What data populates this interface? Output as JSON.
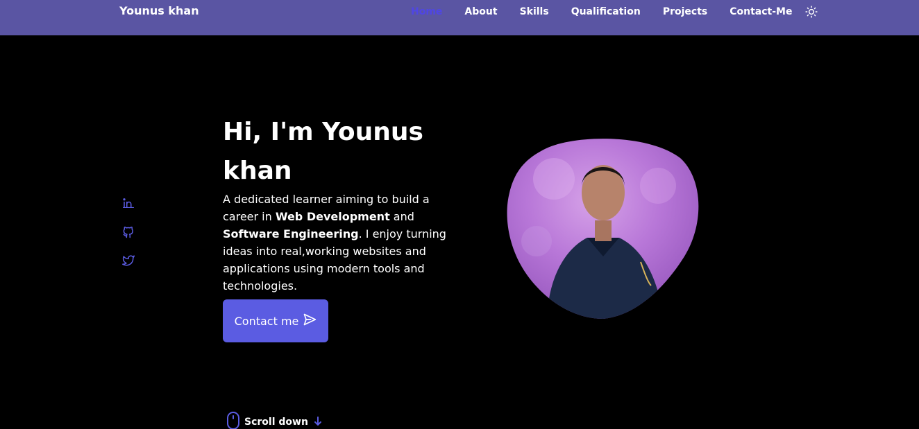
{
  "header": {
    "logo": "Younus khan",
    "nav": [
      {
        "label": "Home",
        "active": true
      },
      {
        "label": "About",
        "active": false
      },
      {
        "label": "Skills",
        "active": false
      },
      {
        "label": "Qualification",
        "active": false
      },
      {
        "label": "Projects",
        "active": false
      },
      {
        "label": "Contact-Me",
        "active": false
      }
    ],
    "theme_icon": "sun-icon"
  },
  "social": [
    {
      "icon": "linkedin-icon"
    },
    {
      "icon": "github-icon"
    },
    {
      "icon": "twitter-icon"
    }
  ],
  "hero": {
    "title": "Hi, I'm Younus khan",
    "desc_1": "A dedicated learner aiming to build a career in ",
    "bold_1": "Web Development",
    "desc_2": " and ",
    "bold_2": "Software Engineering",
    "desc_3": ". I enjoy turning ideas into real,working websites and applications using modern tools and technologies.",
    "contact_label": "Contact me",
    "contact_icon": "send-icon",
    "profile_image": "profile-photo"
  },
  "scroll": {
    "label": "Scroll down",
    "mouse_icon": "mouse-icon",
    "arrow_icon": "arrow-down-icon"
  },
  "colors": {
    "header_bg": "#5a55a3",
    "accent": "#5b5ce2",
    "active_link": "#4f46e5",
    "background": "#000000"
  }
}
